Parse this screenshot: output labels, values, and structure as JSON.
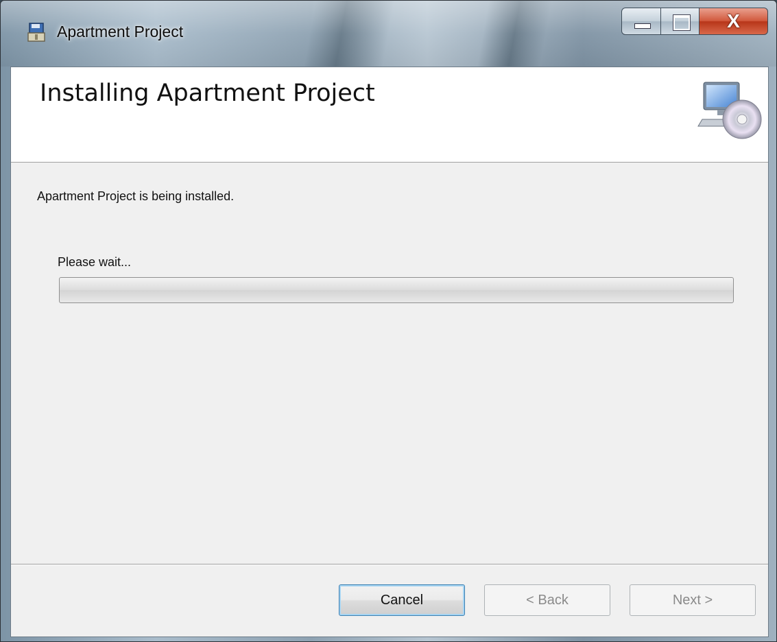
{
  "window": {
    "title": "Apartment Project",
    "icon": "installer-package-icon"
  },
  "caption_buttons": {
    "minimize_icon": "minimize-icon",
    "maximize_icon": "maximize-icon",
    "close_label": "X"
  },
  "banner": {
    "title": "Installing Apartment Project",
    "icon": "computer-cd-icon"
  },
  "body": {
    "status": "Apartment Project is being installed.",
    "wait_label": "Please wait...",
    "progress": 0
  },
  "buttons": {
    "cancel": "Cancel",
    "back": "< Back",
    "next": "Next >"
  },
  "colors": {
    "close_button": "#c8452a",
    "client_background": "#f0f0f0",
    "default_button_focus": "#3c7fb1"
  }
}
